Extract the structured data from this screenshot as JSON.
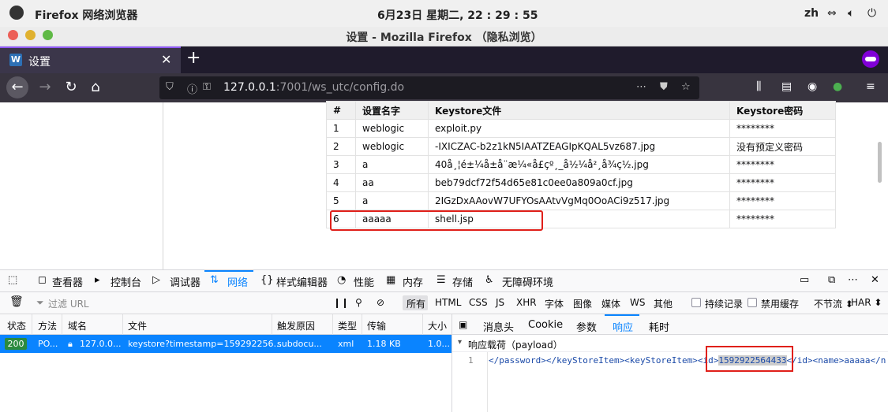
{
  "system_bar": {
    "app_name": "Firefox 网络浏览器",
    "clock": "6月23日 星期二, 22 : 29 : 55",
    "input_method": "zh"
  },
  "window": {
    "title": "设置 - Mozilla Firefox （隐私浏览）"
  },
  "tab": {
    "favicon_letter": "W",
    "label": "设置",
    "close": "✕",
    "new_tab": "+"
  },
  "url": {
    "host": "127.0.0.1",
    "rest": ":7001/ws_utc/config.do"
  },
  "table": {
    "headers": [
      "#",
      "设置名字",
      "Keystore文件",
      "Keystore密码"
    ],
    "rows": [
      [
        "1",
        "weblogic",
        "exploit.py",
        "********"
      ],
      [
        "2",
        "weblogic",
        "-IXICZAC-b2z1kN5IAATZEAGIpKQAL5vz687.jpg",
        "没有预定义密码"
      ],
      [
        "3",
        "a",
        "40å¸¦é±¼å±å¨æ¼«å£çº¸_å½¼å²¸å¾ç½.jpg",
        "********"
      ],
      [
        "4",
        "aa",
        "beb79dcf72f54d65e81c0ee0a809a0cf.jpg",
        "********"
      ],
      [
        "5",
        "a",
        "2IGzDxAAovW7UFYOsAAtvVgMq0OoACi9z517.jpg",
        "********"
      ],
      [
        "6",
        "aaaaa",
        "shell.jsp",
        "********"
      ]
    ]
  },
  "devtools": {
    "tabs": [
      "查看器",
      "控制台",
      "调试器",
      "网络",
      "样式编辑器",
      "性能",
      "内存",
      "存储",
      "无障碍环境"
    ],
    "selected_tab": "网络",
    "filter_placeholder": "过滤 URL",
    "type_filters": [
      "所有",
      "HTML",
      "CSS",
      "JS",
      "XHR",
      "字体",
      "图像",
      "媒体",
      "WS",
      "其他"
    ],
    "persist_label": "持续记录",
    "disable_cache_label": "禁用缓存",
    "throttle_label": "不节流 ⬍",
    "har_label": "HAR ⬍",
    "columns": [
      "状态",
      "方法",
      "域名",
      "文件",
      "触发原因",
      "类型",
      "传输",
      "大小"
    ],
    "request": {
      "status": "200",
      "method": "PO...",
      "domain": "127.0.0...",
      "file": "keystore?timestamp=159292256...",
      "cause": "subdocu...",
      "type": "xml",
      "transferred": "1.18 KB",
      "size": "1.0..."
    },
    "detail_tabs": [
      "消息头",
      "Cookie",
      "参数",
      "响应",
      "耗时"
    ],
    "selected_detail_tab": "响应",
    "payload_label": "响应载荷（payload）",
    "code_line_number": "1",
    "code_before": "</password></keyStoreItem><keyStoreItem><id>",
    "code_highlight": "1592922564433",
    "code_after": "</id><name>aaaaa</n"
  },
  "colors": {
    "accent": "#0a84ff",
    "highlight_box": "#e0201a",
    "status_ok": "#2b8a3e",
    "private_badge": "#8000d7"
  }
}
